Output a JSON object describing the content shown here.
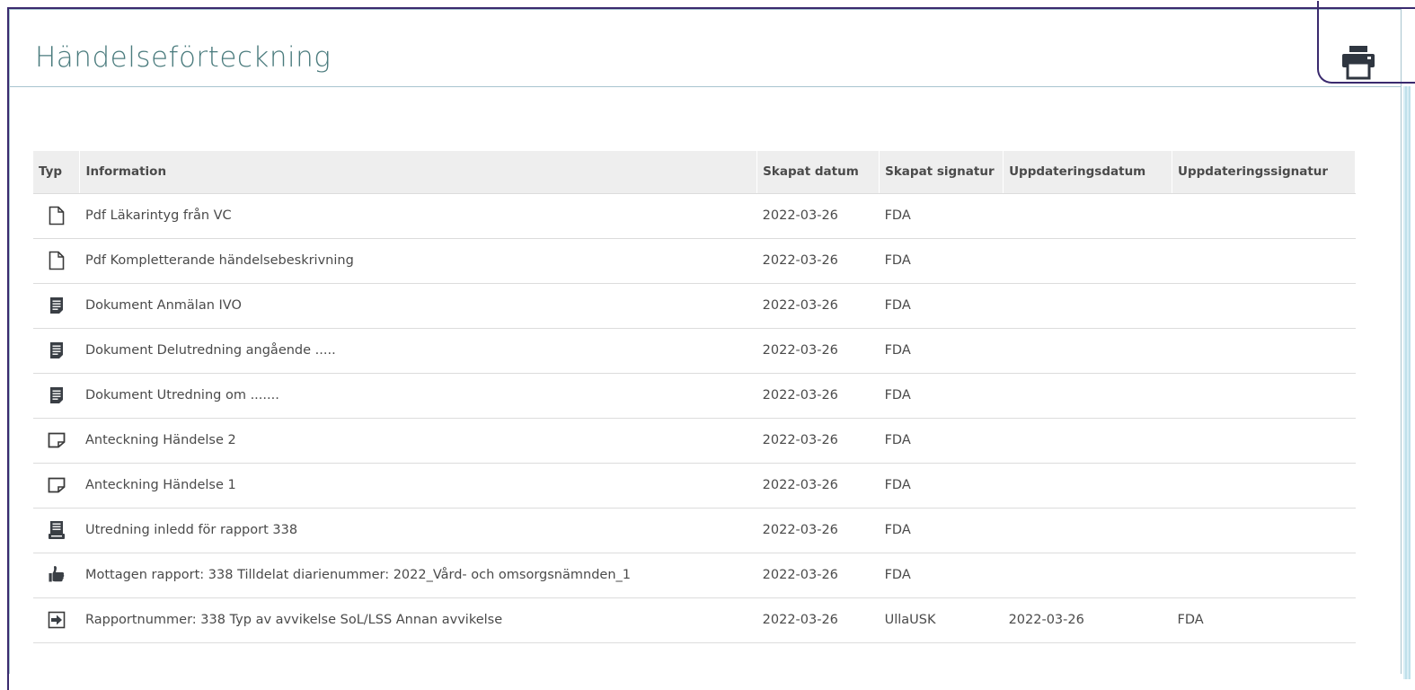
{
  "header": {
    "title": "Händelseförteckning",
    "print_icon": "printer-icon"
  },
  "table": {
    "columns": [
      "Typ",
      "Information",
      "Skapat datum",
      "Skapat signatur",
      "Uppdateringsdatum",
      "Uppdateringssignatur"
    ],
    "rows": [
      {
        "icon": "pdf-file-icon",
        "information": "Pdf Läkarintyg från VC",
        "skapat_datum": "2022-03-26",
        "skapat_signatur": "FDA",
        "uppdateringsdatum": "",
        "uppdateringssignatur": ""
      },
      {
        "icon": "pdf-file-icon",
        "information": "Pdf Kompletterande händelsebeskrivning",
        "skapat_datum": "2022-03-26",
        "skapat_signatur": "FDA",
        "uppdateringsdatum": "",
        "uppdateringssignatur": ""
      },
      {
        "icon": "document-icon",
        "information": "Dokument Anmälan IVO",
        "skapat_datum": "2022-03-26",
        "skapat_signatur": "FDA",
        "uppdateringsdatum": "",
        "uppdateringssignatur": ""
      },
      {
        "icon": "document-icon",
        "information": "Dokument Delutredning angående .....",
        "skapat_datum": "2022-03-26",
        "skapat_signatur": "FDA",
        "uppdateringsdatum": "",
        "uppdateringssignatur": ""
      },
      {
        "icon": "document-icon",
        "information": "Dokument Utredning om .......",
        "skapat_datum": "2022-03-26",
        "skapat_signatur": "FDA",
        "uppdateringsdatum": "",
        "uppdateringssignatur": ""
      },
      {
        "icon": "note-icon",
        "information": "Anteckning Händelse 2",
        "skapat_datum": "2022-03-26",
        "skapat_signatur": "FDA",
        "uppdateringsdatum": "",
        "uppdateringssignatur": ""
      },
      {
        "icon": "note-icon",
        "information": "Anteckning Händelse 1",
        "skapat_datum": "2022-03-26",
        "skapat_signatur": "FDA",
        "uppdateringsdatum": "",
        "uppdateringssignatur": ""
      },
      {
        "icon": "investigation-icon",
        "information": "Utredning inledd för rapport 338",
        "skapat_datum": "2022-03-26",
        "skapat_signatur": "FDA",
        "uppdateringsdatum": "",
        "uppdateringssignatur": ""
      },
      {
        "icon": "thumbs-up-icon",
        "information": "Mottagen rapport: 338 Tilldelat diarienummer: 2022_Vård- och omsorgsnämnden_1",
        "skapat_datum": "2022-03-26",
        "skapat_signatur": "FDA",
        "uppdateringsdatum": "",
        "uppdateringssignatur": ""
      },
      {
        "icon": "sign-in-arrow-icon",
        "information": "Rapportnummer: 338 Typ av avvikelse SoL/LSS Annan avvikelse",
        "skapat_datum": "2022-03-26",
        "skapat_signatur": "UllaUSK",
        "uppdateringsdatum": "2022-03-26",
        "uppdateringssignatur": "FDA"
      }
    ]
  }
}
